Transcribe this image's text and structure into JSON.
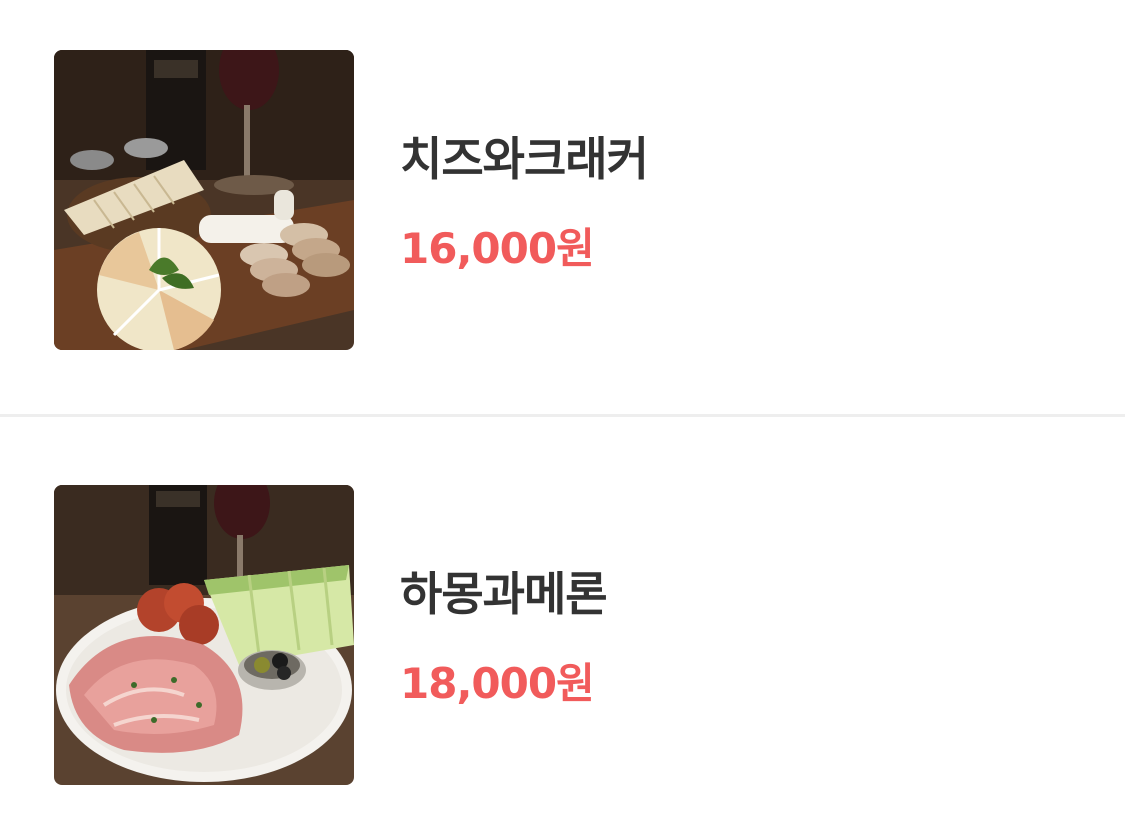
{
  "menu": {
    "items": [
      {
        "name": "치즈와크래커",
        "price": "16,000원",
        "photo_icon": "cheese-platter-photo"
      },
      {
        "name": "하몽과메론",
        "price": "18,000원",
        "photo_icon": "jamon-melon-photo"
      }
    ]
  },
  "colors": {
    "name_text": "#333333",
    "price_text": "#f15b5b",
    "divider": "#eeeeee",
    "background": "#ffffff"
  }
}
